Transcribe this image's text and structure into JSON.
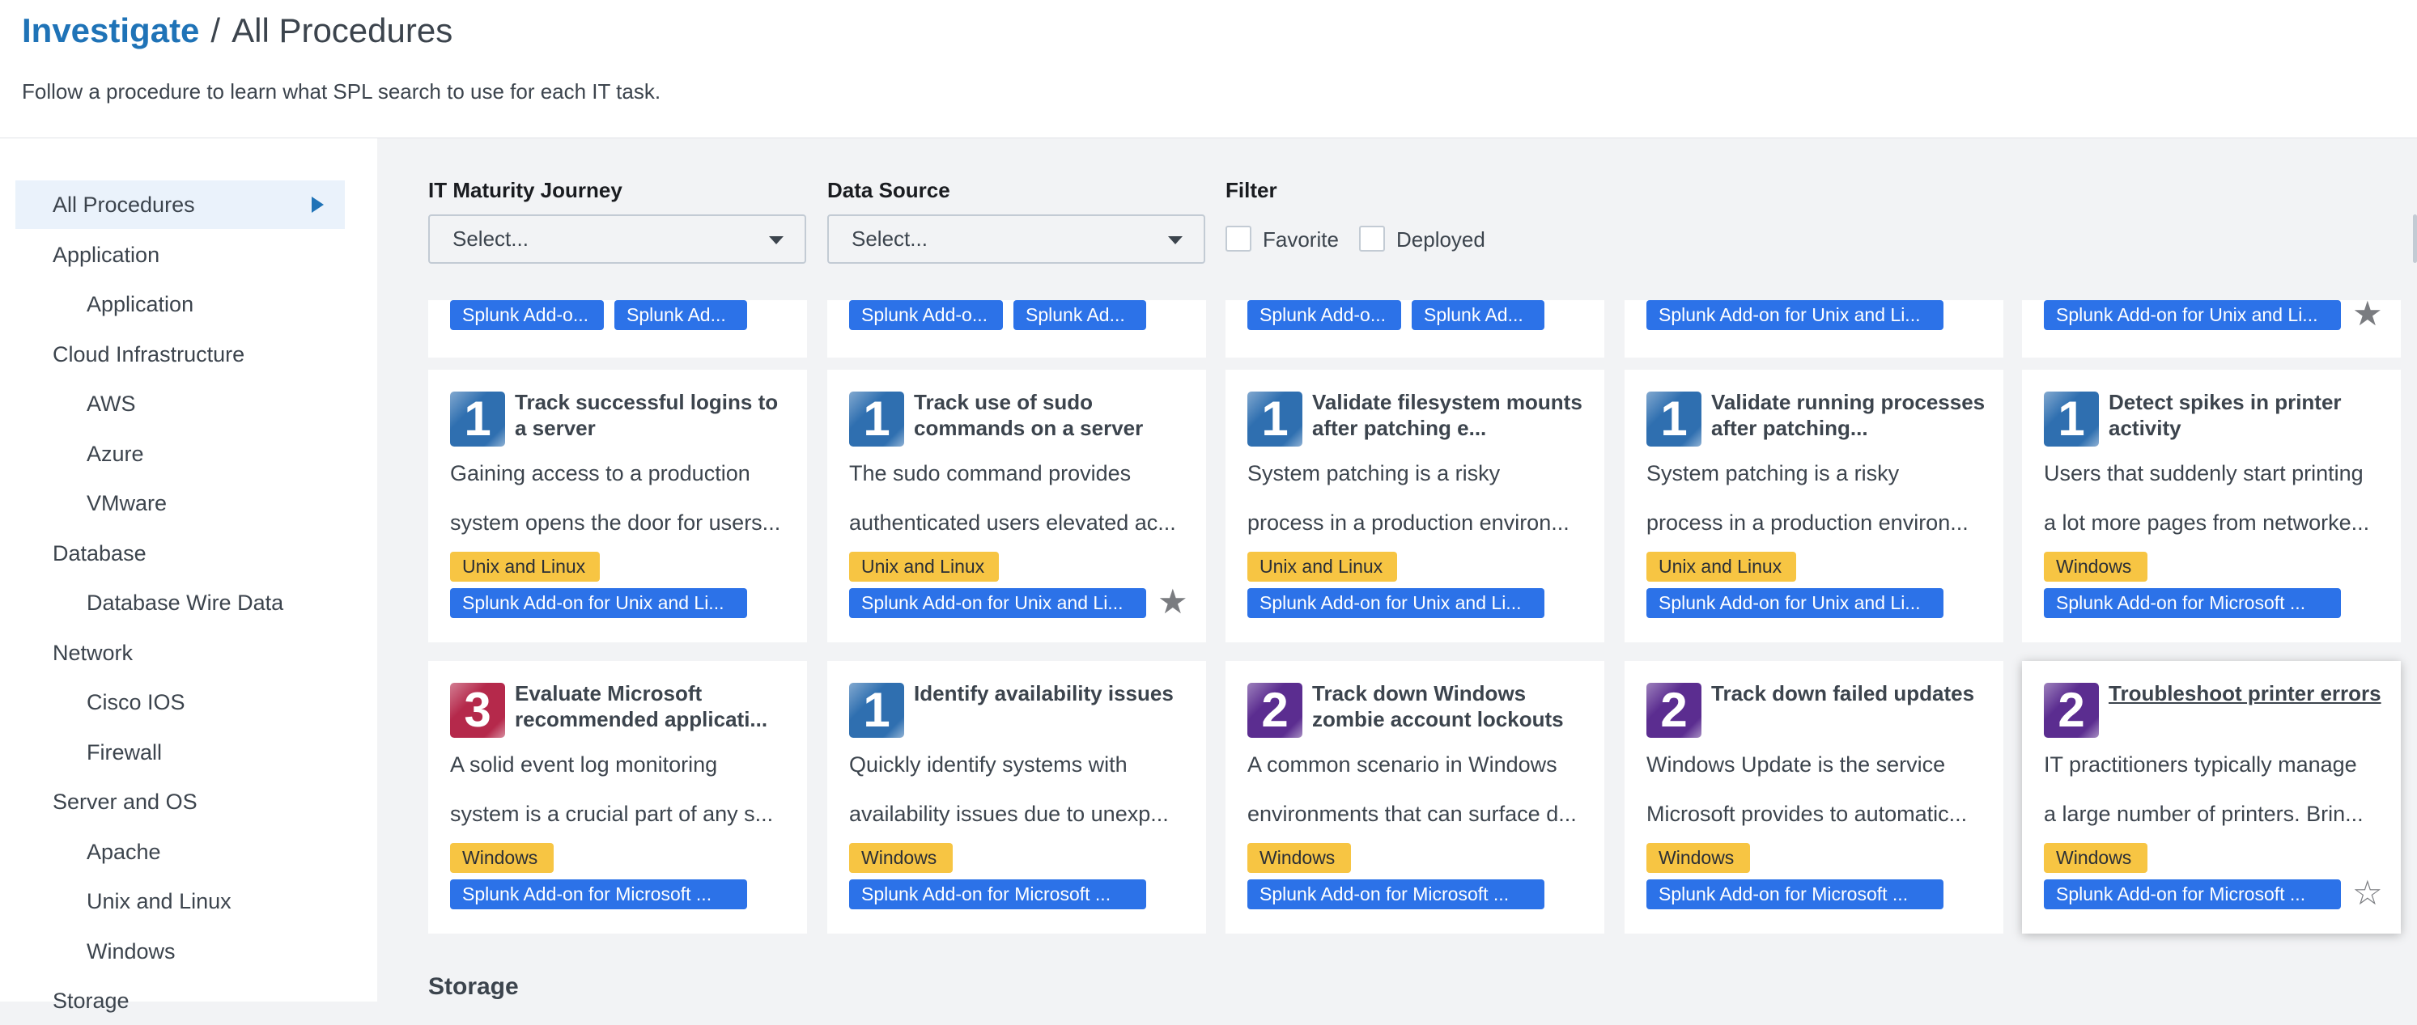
{
  "header": {
    "breadcrumb": "Investigate",
    "separator": "/",
    "title": "All Procedures",
    "subtitle": "Follow a procedure to learn what SPL search to use for each IT task."
  },
  "sidebar": {
    "items": [
      {
        "label": "All Procedures",
        "level": 0,
        "selected": true
      },
      {
        "label": "Application",
        "level": 0
      },
      {
        "label": "Application",
        "level": 1
      },
      {
        "label": "Cloud Infrastructure",
        "level": 0
      },
      {
        "label": "AWS",
        "level": 1
      },
      {
        "label": "Azure",
        "level": 1
      },
      {
        "label": "VMware",
        "level": 1
      },
      {
        "label": "Database",
        "level": 0
      },
      {
        "label": "Database Wire Data",
        "level": 1
      },
      {
        "label": "Network",
        "level": 0
      },
      {
        "label": "Cisco IOS",
        "level": 1
      },
      {
        "label": "Firewall",
        "level": 1
      },
      {
        "label": "Server and OS",
        "level": 0
      },
      {
        "label": "Apache",
        "level": 1
      },
      {
        "label": "Unix and Linux",
        "level": 1
      },
      {
        "label": "Windows",
        "level": 1
      },
      {
        "label": "Storage",
        "level": 0
      }
    ]
  },
  "filters": {
    "maturity": {
      "label": "IT Maturity Journey",
      "placeholder": "Select..."
    },
    "datasource": {
      "label": "Data Source",
      "placeholder": "Select..."
    },
    "filter": {
      "label": "Filter",
      "favorite": "Favorite",
      "deployed": "Deployed"
    }
  },
  "colors": {
    "level1": "#2f6fb0",
    "level2": "#5b2d90",
    "level3": "#b5294b",
    "tag_yellow": "#f7c543",
    "tag_blue": "#2c72e8"
  },
  "partial_row": [
    {
      "tags": [
        "Splunk Add-o...",
        "Splunk Ad..."
      ],
      "star": false
    },
    {
      "tags": [
        "Splunk Add-o...",
        "Splunk Ad..."
      ],
      "star": false
    },
    {
      "tags": [
        "Splunk Add-o...",
        "Splunk Ad..."
      ],
      "star": false
    },
    {
      "tags": [
        "Splunk Add-on for Unix and Li..."
      ],
      "star": false
    },
    {
      "tags": [
        "Splunk Add-on for Unix and Li..."
      ],
      "star": "filled"
    }
  ],
  "cards": [
    {
      "level": "1",
      "title": "Track successful logins to a server",
      "desc": [
        "Gaining access to a production",
        "system opens the door for users..."
      ],
      "category": "Unix and Linux",
      "addon": "Splunk Add-on for Unix and Li...",
      "star": false
    },
    {
      "level": "1",
      "title": "Track use of sudo commands on a server",
      "desc": [
        "The sudo command provides",
        "authenticated users elevated ac..."
      ],
      "category": "Unix and Linux",
      "addon": "Splunk Add-on for Unix and Li...",
      "star": "filled"
    },
    {
      "level": "1",
      "title": "Validate filesystem mounts after patching e...",
      "desc": [
        "System patching is a risky",
        "process in a production environ..."
      ],
      "category": "Unix and Linux",
      "addon": "Splunk Add-on for Unix and Li...",
      "star": false
    },
    {
      "level": "1",
      "title": "Validate running processes after patching...",
      "desc": [
        "System patching is a risky",
        "process in a production environ..."
      ],
      "category": "Unix and Linux",
      "addon": "Splunk Add-on for Unix and Li...",
      "star": false
    },
    {
      "level": "1",
      "title": "Detect spikes in printer activity",
      "desc": [
        "Users that suddenly start printing",
        "a lot more pages from networke..."
      ],
      "category": "Windows",
      "addon": "Splunk Add-on for Microsoft ...",
      "star": false
    },
    {
      "level": "3",
      "title": "Evaluate Microsoft recommended applicati...",
      "desc": [
        "A solid event log monitoring",
        "system is a crucial part of any s..."
      ],
      "category": "Windows",
      "addon": "Splunk Add-on for Microsoft ...",
      "star": false
    },
    {
      "level": "1",
      "title": "Identify availability issues",
      "desc": [
        "Quickly identify systems with",
        "availability issues due to unexp..."
      ],
      "category": "Windows",
      "addon": "Splunk Add-on for Microsoft ...",
      "star": false
    },
    {
      "level": "2",
      "title": "Track down Windows zombie account lockouts",
      "desc": [
        "A common scenario in Windows",
        "environments that can surface d..."
      ],
      "category": "Windows",
      "addon": "Splunk Add-on for Microsoft ...",
      "star": false
    },
    {
      "level": "2",
      "title": "Track down failed updates",
      "desc": [
        "Windows Update is the service",
        "Microsoft provides to automatic..."
      ],
      "category": "Windows",
      "addon": "Splunk Add-on for Microsoft ...",
      "star": false
    },
    {
      "level": "2",
      "title": "Troubleshoot printer errors",
      "desc": [
        "IT practitioners typically manage",
        "a large number of printers. Brin..."
      ],
      "category": "Windows",
      "addon": "Splunk Add-on for Microsoft ...",
      "star": "outline",
      "hovered": true
    }
  ],
  "section": {
    "next": "Storage"
  }
}
